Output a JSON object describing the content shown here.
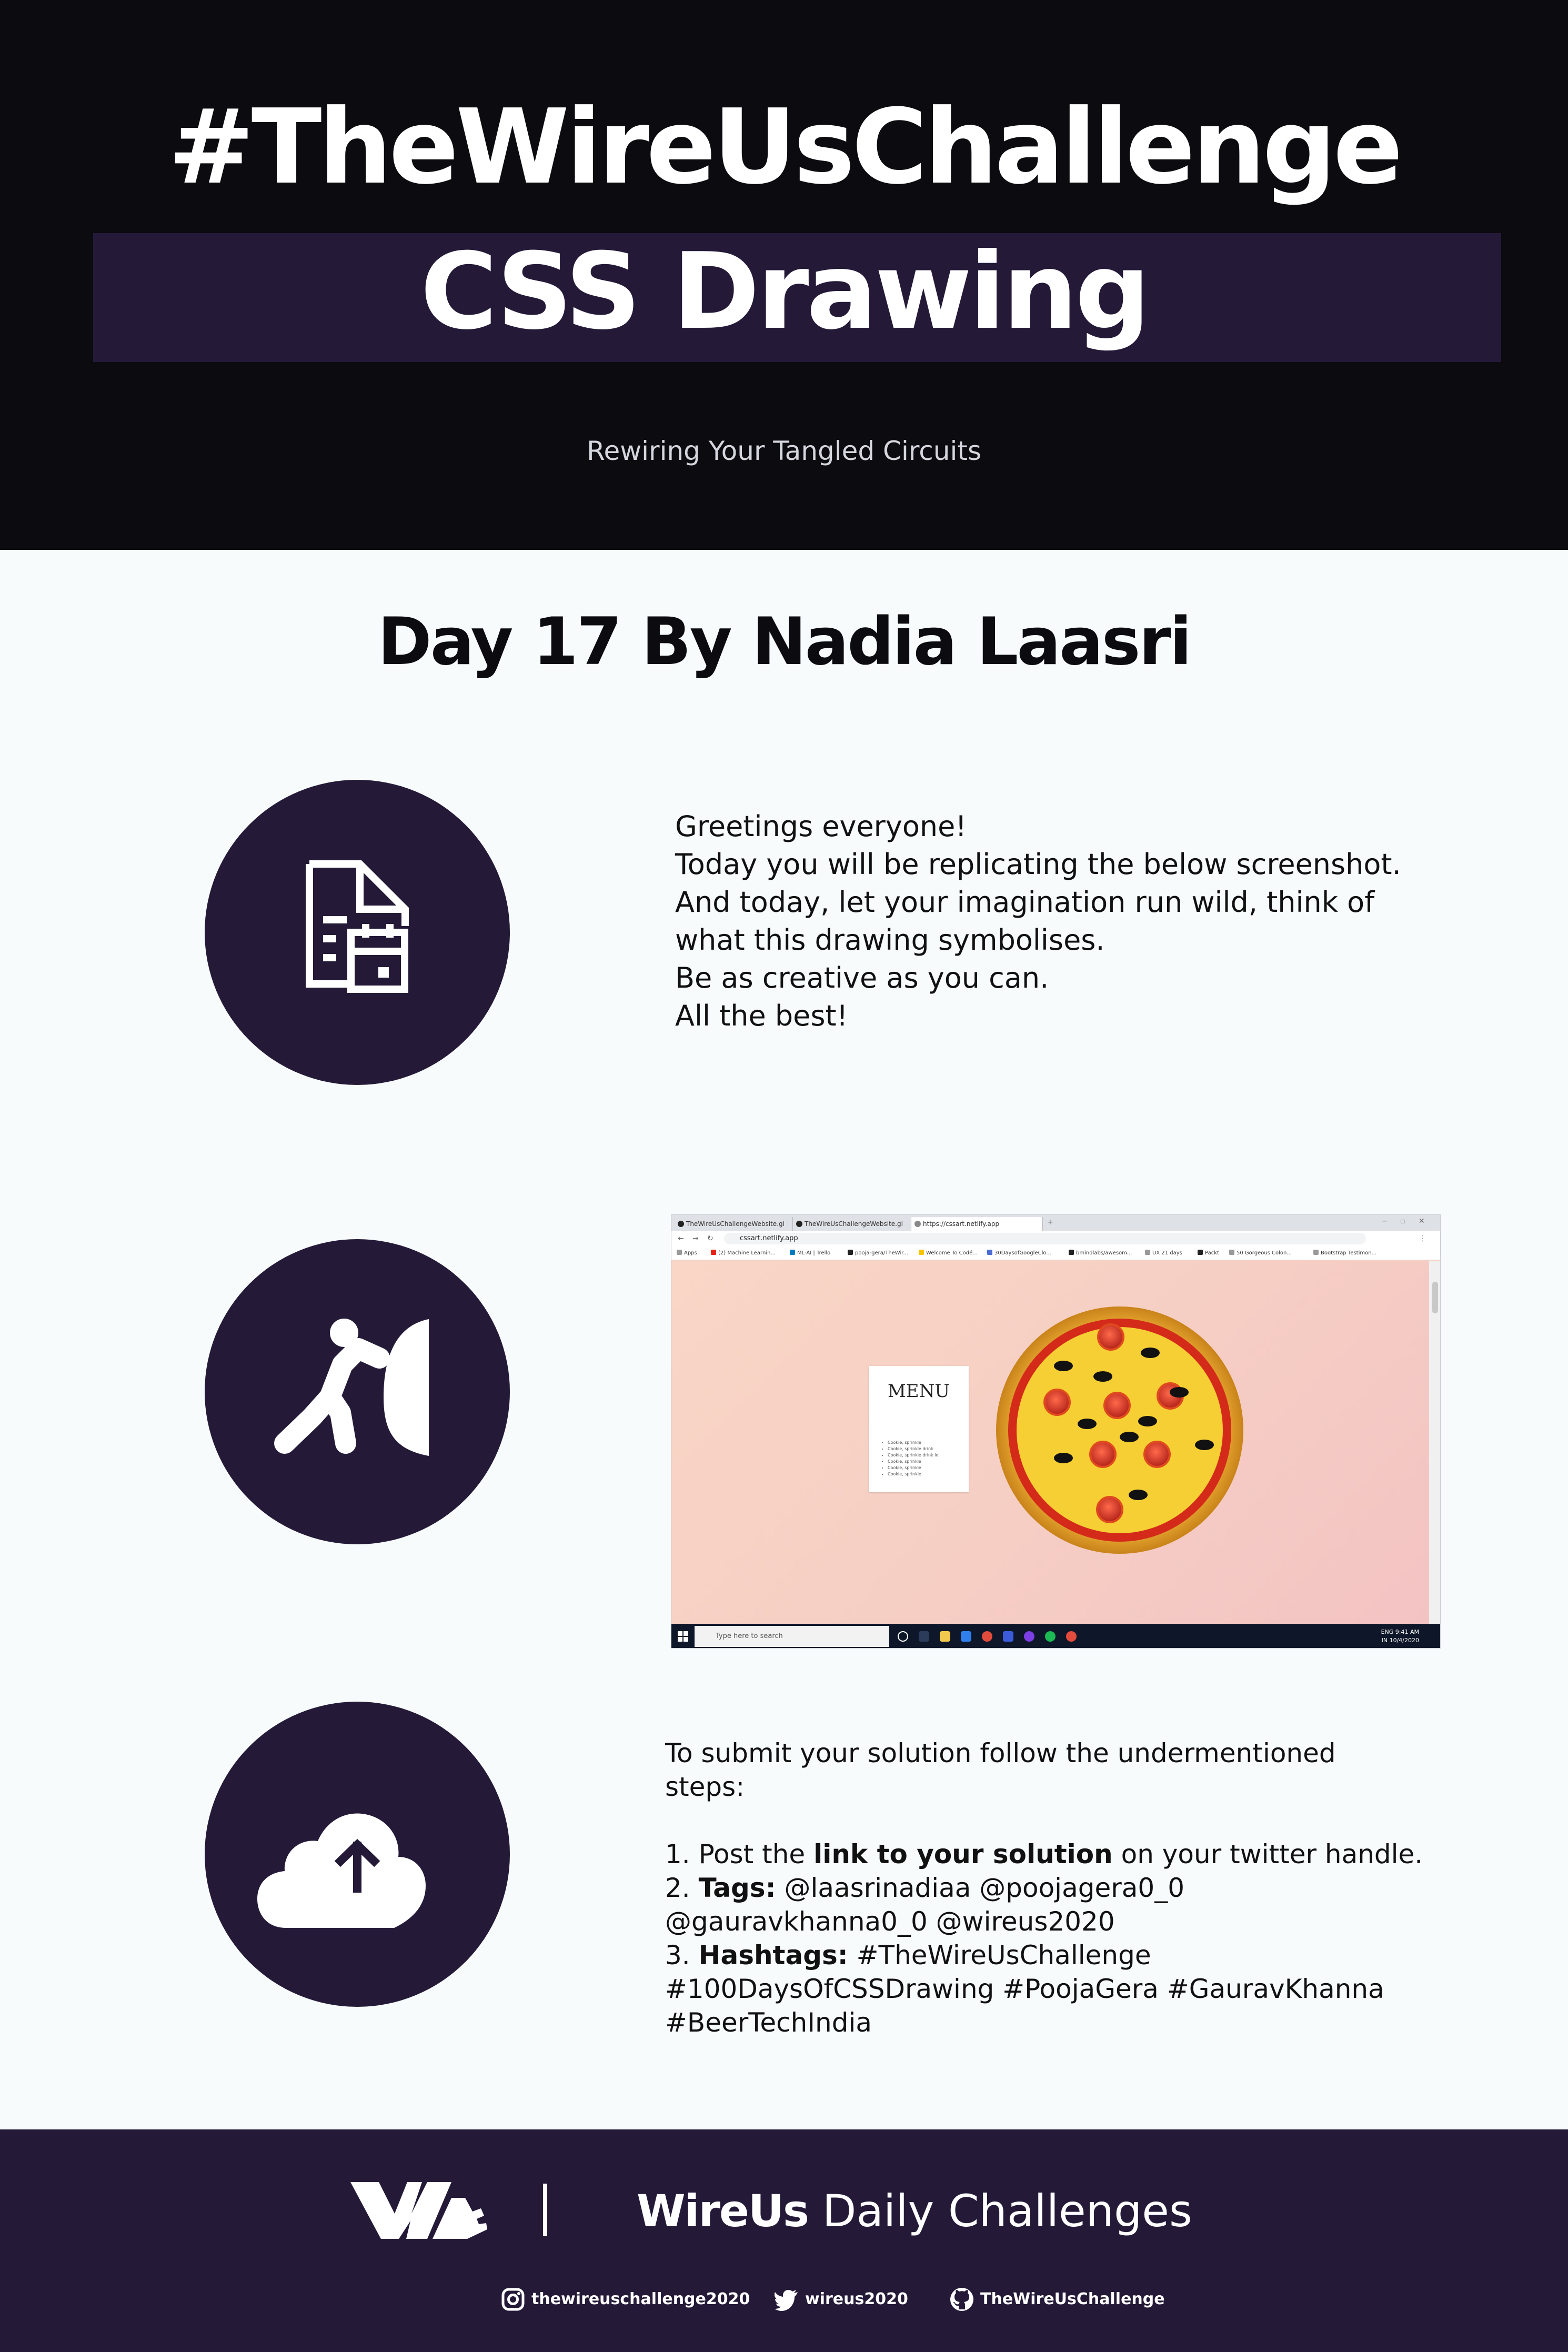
{
  "header": {
    "title": "#TheWireUsChallenge",
    "subtitle": "CSS Drawing",
    "tagline": "Rewiring Your Tangled Circuits"
  },
  "day_title": "Day 17 By Nadia Laasri",
  "intro": {
    "lines": [
      "Greetings everyone!",
      "Today you will be replicating the below screenshot.",
      "And today, let your imagination run wild, think of",
      "what this drawing symbolises.",
      "Be as creative as you can.",
      "All the best!"
    ]
  },
  "icons": {
    "step1": "document-calendar-icon",
    "step2": "person-pushing-icon",
    "step3": "cloud-upload-icon"
  },
  "screenshot": {
    "tabs": [
      "TheWireUsChallengeWebsite.gi",
      "TheWireUsChallengeWebsite.gi",
      "https://cssart.netlify.app"
    ],
    "address": "cssart.netlify.app",
    "bookmarks": [
      "Apps",
      "(2) Machine Learnin...",
      "ML-AI | Trello",
      "pooja-gera/TheWir...",
      "Welcome To Codé...",
      "30DaysofGoogleClo...",
      "bmindlabs/awesom...",
      "UX 21 days",
      "Packt",
      "50 Gorgeous Colon...",
      "Bootstrap Testimon..."
    ],
    "menu_title": "MENU",
    "menu_items": [
      "Cookie, sprinkle",
      "Cookie, sprinkle drink",
      "Cookie, sprinkle drink lol",
      "Cookie, sprinkle",
      "Cookie, sprinkle",
      "Cookie, sprinkle"
    ],
    "taskbar_search": "Type here to search",
    "clock_time": "9:41 AM",
    "clock_date": "10/4/2020",
    "clock_lang": "ENG",
    "clock_region": "IN",
    "colors": {
      "background": "#f6cfc4",
      "crust": "#e6a11e",
      "sauce": "#d42a1a",
      "cheese": "#f6cf34",
      "pepperoni": "#c8301c",
      "olive": "#111111"
    }
  },
  "submit": {
    "intro_line1": "To submit your solution follow the undermentioned",
    "intro_line2": "steps:",
    "step1_num": "1. Post the ",
    "step1_bold": "link to your solution",
    "step1_rest": " on your twitter handle.",
    "step2_num": "2. ",
    "step2_bold": "Tags:",
    "step2_rest": " @laasrinadiaa @poojagera0_0",
    "step2_cont": "@gauravkhanna0_0 @wireus2020",
    "step3_num": "3. ",
    "step3_bold": "Hashtags:",
    "step3_rest": " #TheWireUsChallenge",
    "step3_cont1": "#100DaysOfCSSDrawing #PoojaGera #GauravKhanna",
    "step3_cont2": "#BeerTechIndia"
  },
  "footer": {
    "brand_bold": "WireUs",
    "brand_rest": " Daily Challenges",
    "instagram": "thewireuschallenge2020",
    "twitter": "wireus2020",
    "github": "TheWireUsChallenge"
  },
  "colors": {
    "dark": "#0b0b10",
    "purple": "#241a38",
    "light_bg": "#f7fbfc"
  }
}
